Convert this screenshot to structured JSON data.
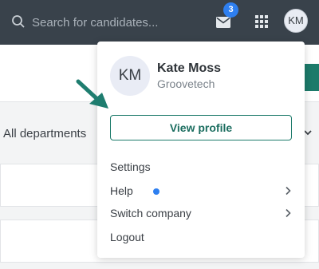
{
  "topbar": {
    "search_placeholder": "Search for candidates...",
    "mail_badge_count": "3",
    "avatar_initials": "KM"
  },
  "page": {
    "department_filter": "All departments"
  },
  "dropdown": {
    "avatar_initials": "KM",
    "user_name": "Kate Moss",
    "company": "Groovetech",
    "view_profile_label": "View profile",
    "items": [
      {
        "label": "Settings"
      },
      {
        "label": "Help"
      },
      {
        "label": "Switch company"
      },
      {
        "label": "Logout"
      }
    ]
  },
  "colors": {
    "topbar_bg": "#39424b",
    "accent_green": "#1c7a6a",
    "badge_blue": "#2e7ff0",
    "arrow_teal": "#1e7d6f"
  },
  "icons": [
    "search-icon",
    "mail-icon",
    "apps-grid-icon",
    "chevron-down-icon",
    "chevron-right-icon",
    "help-notification-dot"
  ]
}
